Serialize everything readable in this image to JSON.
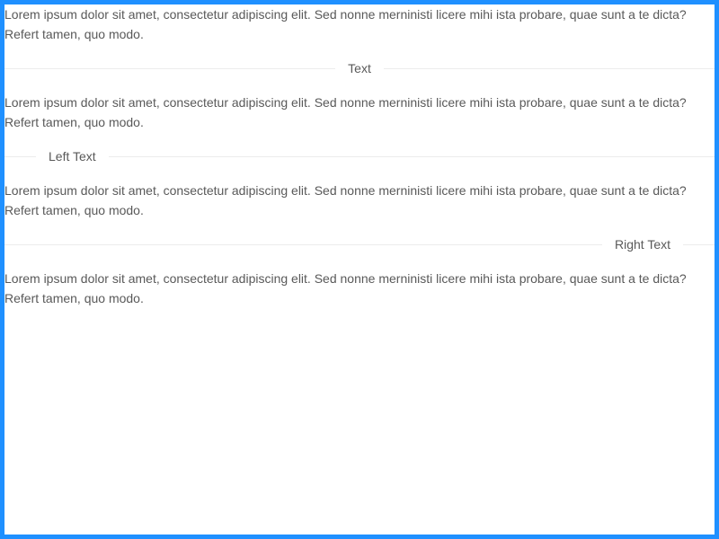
{
  "colors": {
    "frame_border": "#1f90ff",
    "text": "#595959",
    "divider_line": "#ececec",
    "background": "#ffffff"
  },
  "paragraphs": [
    {
      "text": "Lorem ipsum dolor sit amet, consectetur adipiscing elit. Sed nonne merninisti licere mihi ista probare, quae sunt a te dicta? Refert tamen, quo modo."
    },
    {
      "text": "Lorem ipsum dolor sit amet, consectetur adipiscing elit. Sed nonne merninisti licere mihi ista probare, quae sunt a te dicta? Refert tamen, quo modo."
    },
    {
      "text": "Lorem ipsum dolor sit amet, consectetur adipiscing elit. Sed nonne merninisti licere mihi ista probare, quae sunt a te dicta? Refert tamen, quo modo."
    },
    {
      "text": "Lorem ipsum dolor sit amet, consectetur adipiscing elit. Sed nonne merninisti licere mihi ista probare, quae sunt a te dicta? Refert tamen, quo modo."
    }
  ],
  "dividers": [
    {
      "label": "Text",
      "orientation": "center"
    },
    {
      "label": "Left Text",
      "orientation": "left"
    },
    {
      "label": "Right Text",
      "orientation": "right"
    }
  ]
}
